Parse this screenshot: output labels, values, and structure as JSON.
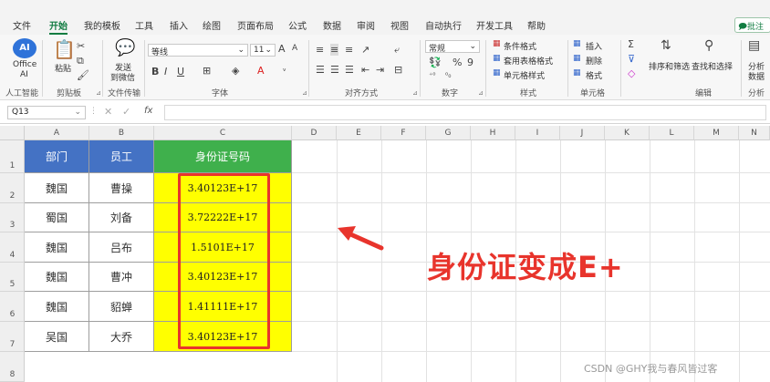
{
  "menu": {
    "tabs": [
      "文件",
      "开始",
      "我的模板",
      "工具",
      "插入",
      "绘图",
      "页面布局",
      "公式",
      "数据",
      "审阅",
      "视图",
      "自动执行",
      "开发工具",
      "帮助"
    ],
    "active": "开始",
    "comment_label": "批注"
  },
  "ribbon": {
    "office_ai": {
      "label1": "Office",
      "label2": "AI",
      "group": "人工智能"
    },
    "clipboard": {
      "paste": "粘贴",
      "group": "剪贴板"
    },
    "wechat": {
      "line1": "发送",
      "line2": "到微信",
      "group": "文件传输"
    },
    "font": {
      "name": "等线",
      "size": "11",
      "grow": "A",
      "shrink": "A",
      "group": "字体",
      "bold": "B",
      "italic": "I",
      "underline": "U"
    },
    "alignment": {
      "group": "对齐方式"
    },
    "number": {
      "format": "常规",
      "group": "数字"
    },
    "styles": {
      "conditional": "条件格式",
      "table": "套用表格格式",
      "cell": "单元格样式",
      "group": "样式"
    },
    "cells": {
      "insert": "插入",
      "delete": "删除",
      "format": "格式",
      "group": "单元格"
    },
    "editing": {
      "sort": "排序和筛选",
      "find": "查找和选择",
      "group": "编辑"
    },
    "analysis": {
      "line1": "分析",
      "line2": "数据",
      "group": "分析"
    }
  },
  "formula_bar": {
    "name_box": "Q13",
    "fx": "fx",
    "value": ""
  },
  "columns": [
    "A",
    "B",
    "C",
    "D",
    "E",
    "F",
    "G",
    "H",
    "I",
    "J",
    "K",
    "L",
    "M",
    "N"
  ],
  "rows": [
    "1",
    "2",
    "3",
    "4",
    "5",
    "6",
    "7",
    "8"
  ],
  "table": {
    "headers": [
      "部门",
      "员工",
      "身份证号码"
    ],
    "rows": [
      [
        "魏国",
        "曹操",
        "3.40123E+17"
      ],
      [
        "蜀国",
        "刘备",
        "3.72222E+17"
      ],
      [
        "魏国",
        "吕布",
        "1.5101E+17"
      ],
      [
        "魏国",
        "曹冲",
        "3.40123E+17"
      ],
      [
        "魏国",
        "貂蝉",
        "1.41111E+17"
      ],
      [
        "吴国",
        "大乔",
        "3.40123E+17"
      ]
    ]
  },
  "annotation": {
    "note": "身份证变成E+"
  },
  "watermark": "CSDN @GHY我与春风皆过客",
  "colors": {
    "accent": "#107c41",
    "header_blue": "#4472c4",
    "header_green": "#3fb04c",
    "highlight": "#ffff00",
    "annotation_red": "#e8342c"
  }
}
